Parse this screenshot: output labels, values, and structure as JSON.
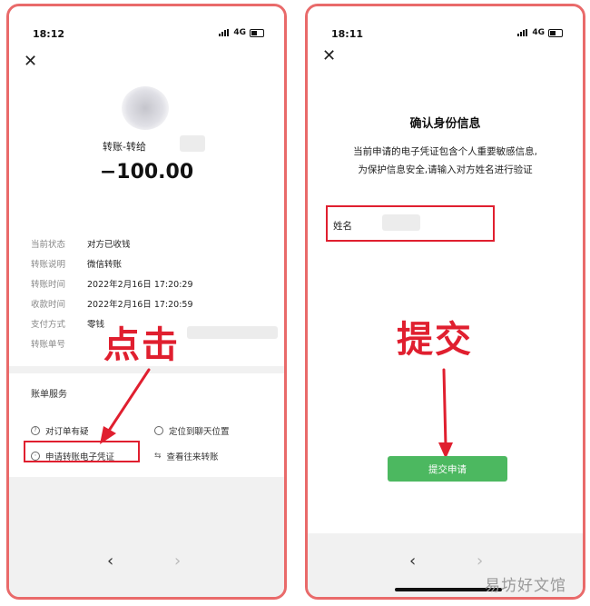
{
  "colors": {
    "frame": "#e96a6a",
    "highlight": "#e01f2f",
    "accent_green": "#4cb860"
  },
  "left": {
    "time": "18:12",
    "network": "4G",
    "close_icon": "close-icon",
    "transfer_title": "转账-转给",
    "amount": "−100.00",
    "details": [
      {
        "key": "当前状态",
        "value": "对方已收钱"
      },
      {
        "key": "转账说明",
        "value": "微信转账"
      },
      {
        "key": "转账时间",
        "value": "2022年2月16日 17:20:29"
      },
      {
        "key": "收款时间",
        "value": "2022年2月16日 17:20:59"
      },
      {
        "key": "支付方式",
        "value": "零钱"
      },
      {
        "key": "转账单号",
        "value": ""
      }
    ],
    "annotation": "点击",
    "services_title": "账单服务",
    "services": {
      "question": "对订单有疑",
      "locate_chat": "定位到聊天位置",
      "apply_voucher": "申请转账电子凭证",
      "view_history": "查看往来转账"
    },
    "nav_back": "‹",
    "nav_forward": "›"
  },
  "right": {
    "time": "18:11",
    "network": "4G",
    "close_icon": "close-icon",
    "title": "确认身份信息",
    "desc_line1": "当前申请的电子凭证包含个人重要敏感信息,",
    "desc_line2": "为保护信息安全,请输入对方姓名进行验证",
    "name_label": "姓名",
    "annotation": "提交",
    "submit_label": "提交申请",
    "nav_back": "‹",
    "nav_forward": "›"
  },
  "watermark": "易坊好文馆"
}
